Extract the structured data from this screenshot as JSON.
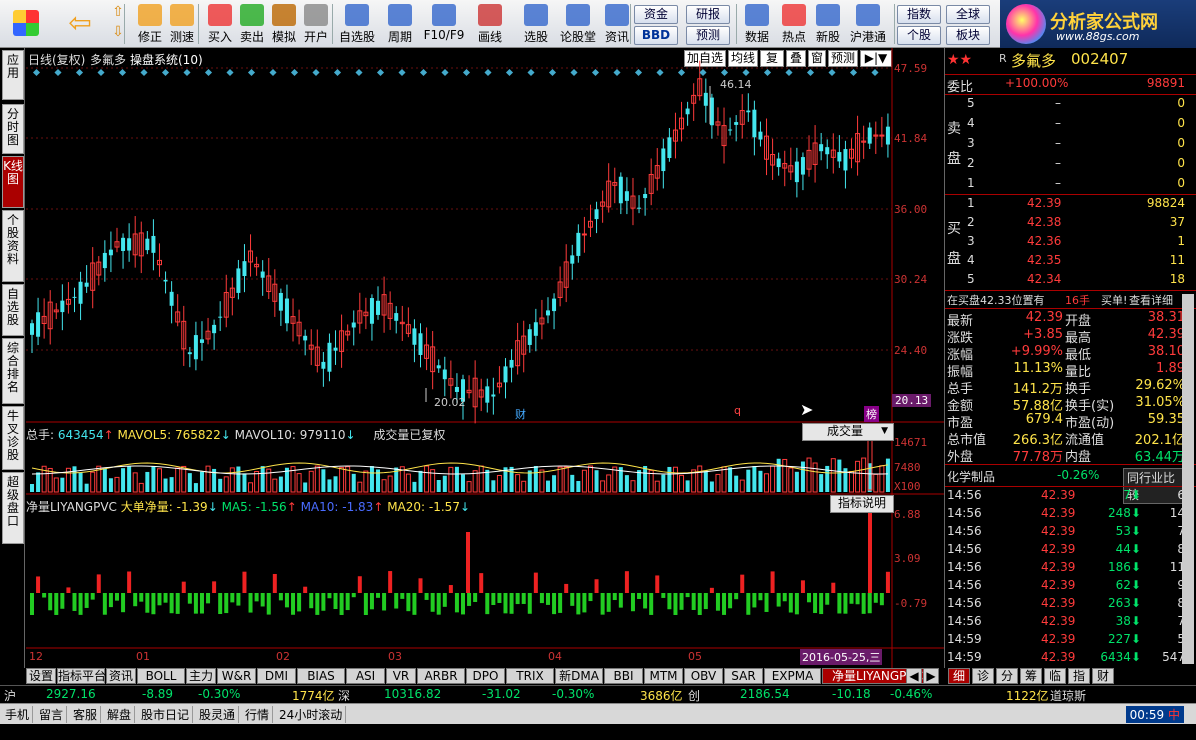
{
  "toolbar": {
    "buttons": [
      {
        "label": "修正",
        "icon": "refresh-icon"
      },
      {
        "label": "测速",
        "icon": "clock-icon"
      },
      {
        "label": "买入",
        "icon": "buy-icon"
      },
      {
        "label": "卖出",
        "icon": "sell-icon"
      },
      {
        "label": "模拟",
        "icon": "hammer-icon"
      },
      {
        "label": "开户",
        "icon": "lock-icon"
      },
      {
        "label": "自选股",
        "icon": "star-icon"
      },
      {
        "label": "周期",
        "icon": "clock-icon"
      },
      {
        "label": "F10/F9",
        "icon": "document-icon"
      },
      {
        "label": "画线",
        "icon": "pen-icon"
      },
      {
        "label": "选股",
        "icon": "screen-icon"
      },
      {
        "label": "论股堂",
        "icon": "chat-icon"
      },
      {
        "label": "资讯",
        "icon": "news-icon"
      },
      {
        "label": "数据",
        "icon": "pe-icon"
      },
      {
        "label": "热点",
        "icon": "fire-icon"
      },
      {
        "label": "新股",
        "icon": "new-stock-icon"
      },
      {
        "label": "沪港通",
        "icon": "hk-icon"
      }
    ],
    "small": {
      "zijin": "资金",
      "yanbao": "研报",
      "bbd": "BBD",
      "yuce": "预测",
      "zhishu": "指数",
      "quanqiu": "全球",
      "gegu": "个股",
      "bankuai": "板块"
    },
    "logo": {
      "title": "分析家公式网",
      "url": "www.88gs.com"
    }
  },
  "left_tabs": [
    "应用",
    "分时图",
    "K线图",
    "个股资料",
    "自选股",
    "综合排名",
    "牛叉诊股",
    "超级盘口"
  ],
  "chart": {
    "header": {
      "period": "日线(复权)",
      "stock": "多氟多",
      "system": "操盘系统(10)"
    },
    "controls": [
      "加自选",
      "均线",
      "复权",
      "叠",
      "窗",
      "预测"
    ],
    "price_labels": [
      "47.59",
      "41.84",
      "36.00",
      "30.24",
      "24.40",
      "20.13"
    ],
    "high_label": "46.14",
    "low_label": "20.02",
    "markers": {
      "cai": "财",
      "q": "q",
      "bang": "榜"
    },
    "volume": {
      "total_label": "总手: ",
      "total": "643454",
      "mavol5_label": "MAVOL5: ",
      "mavol5": "765822",
      "mavol10_label": "MAVOL10: ",
      "mavol10": "979110",
      "note": "成交量已复权",
      "dropdown": "成交量",
      "ticks": [
        "14671",
        "7480",
        "X100"
      ]
    },
    "indicator": {
      "name": "净量LIYANGPVC",
      "big_label": "大单净量: ",
      "big": "-1.39",
      "ma5_label": "MA5: ",
      "ma5": "-1.56",
      "ma10_label": "MA10: ",
      "ma10": "-1.83",
      "ma20_label": "MA20: ",
      "ma20": "-1.57",
      "help": "指标说明",
      "ticks": [
        "6.88",
        "3.09",
        "-0.79"
      ]
    },
    "months": [
      "12",
      "01",
      "02",
      "03",
      "04",
      "05"
    ],
    "date_tag": "2016-05-25,三"
  },
  "right": {
    "title": "多氟多",
    "code": "002407",
    "prefix": "R",
    "weibi_label": "委比",
    "weibi": "+100.00%",
    "weicha": "98891",
    "sell_label": "卖盘",
    "sell": [
      {
        "n": "5",
        "p": "–",
        "v": "0"
      },
      {
        "n": "4",
        "p": "–",
        "v": "0"
      },
      {
        "n": "3",
        "p": "–",
        "v": "0"
      },
      {
        "n": "2",
        "p": "–",
        "v": "0"
      },
      {
        "n": "1",
        "p": "–",
        "v": "0"
      }
    ],
    "buy_label": "买盘",
    "buy": [
      {
        "n": "1",
        "p": "42.39",
        "v": "98824"
      },
      {
        "n": "2",
        "p": "42.38",
        "v": "37"
      },
      {
        "n": "3",
        "p": "42.36",
        "v": "1"
      },
      {
        "n": "4",
        "p": "42.35",
        "v": "11"
      },
      {
        "n": "5",
        "p": "42.34",
        "v": "18"
      }
    ],
    "notice": "在买盘42.33位置有",
    "notice_amt": "16手",
    "notice_act": "买单!",
    "notice_link": "查看详细",
    "stats": [
      {
        "l": "最新",
        "v": "42.39",
        "l2": "开盘",
        "v2": "38.31"
      },
      {
        "l": "涨跌",
        "v": "+3.85",
        "l2": "最高",
        "v2": "42.39"
      },
      {
        "l": "涨幅",
        "v": "+9.99%",
        "l2": "最低",
        "v2": "38.10"
      },
      {
        "l": "振幅",
        "v": "11.13%",
        "l2": "量比",
        "v2": "1.89"
      },
      {
        "l": "总手",
        "v": "141.2万",
        "l2": "换手",
        "v2": "29.62%"
      },
      {
        "l": "金额",
        "v": "57.88亿",
        "l2": "换手(实)",
        "v2": "31.05%"
      },
      {
        "l": "市盈",
        "v": "679.4",
        "l2": "市盈(动)",
        "v2": "59.35"
      },
      {
        "l": "总市值",
        "v": "266.3亿",
        "l2": "流通值",
        "v2": "202.1亿"
      },
      {
        "l": "外盘",
        "v": "77.78万",
        "l2": "内盘",
        "v2": "63.44万"
      }
    ],
    "sector": "化学制品",
    "sector_chg": "-0.26%",
    "compare": "同行业比较",
    "ticks": [
      {
        "t": "14:56",
        "p": "42.39",
        "v": "7",
        "n": "6"
      },
      {
        "t": "14:56",
        "p": "42.39",
        "v": "248",
        "n": "14"
      },
      {
        "t": "14:56",
        "p": "42.39",
        "v": "53",
        "n": "7"
      },
      {
        "t": "14:56",
        "p": "42.39",
        "v": "44",
        "n": "8"
      },
      {
        "t": "14:56",
        "p": "42.39",
        "v": "186",
        "n": "11"
      },
      {
        "t": "14:56",
        "p": "42.39",
        "v": "62",
        "n": "9"
      },
      {
        "t": "14:56",
        "p": "42.39",
        "v": "263",
        "n": "8"
      },
      {
        "t": "14:56",
        "p": "42.39",
        "v": "38",
        "n": "7"
      },
      {
        "t": "14:59",
        "p": "42.39",
        "v": "227",
        "n": "5"
      },
      {
        "t": "14:59",
        "p": "42.39",
        "v": "6434",
        "n": "547"
      }
    ],
    "tabs": [
      "细",
      "诊",
      "分",
      "筹",
      "临",
      "指",
      "财"
    ]
  },
  "bottom_tabs": [
    "设置",
    "指标平台",
    "资讯",
    "BOLL",
    "主力",
    "W&R",
    "DMI",
    "BIAS",
    "ASI",
    "VR",
    "ARBR",
    "DPO",
    "TRIX",
    "新DMA",
    "BBI",
    "MTM",
    "OBV",
    "SAR",
    "EXPMA",
    "净量LIYANGPVC"
  ],
  "ticker": {
    "sh": {
      "n": "沪",
      "v": "2927.16",
      "c": "-8.89",
      "p": "-0.30%",
      "a": "1774亿"
    },
    "sz": {
      "n": "深",
      "v": "10316.82",
      "c": "-31.02",
      "p": "-0.30%",
      "a": "3686亿"
    },
    "cy": {
      "n": "创",
      "v": "2186.54",
      "c": "-10.18",
      "p": "-0.46%",
      "a": "1122亿"
    },
    "dj": "道琼斯"
  },
  "status": {
    "items": [
      "手机",
      "留言",
      "客服",
      "解盘",
      "股市日记",
      "股灵通",
      "行情",
      "24小时滚动"
    ],
    "time": "00:59",
    "tag": "中"
  },
  "colors": {
    "up": "#ff3b3b",
    "down": "#44e6ee",
    "bg": "#000000"
  }
}
